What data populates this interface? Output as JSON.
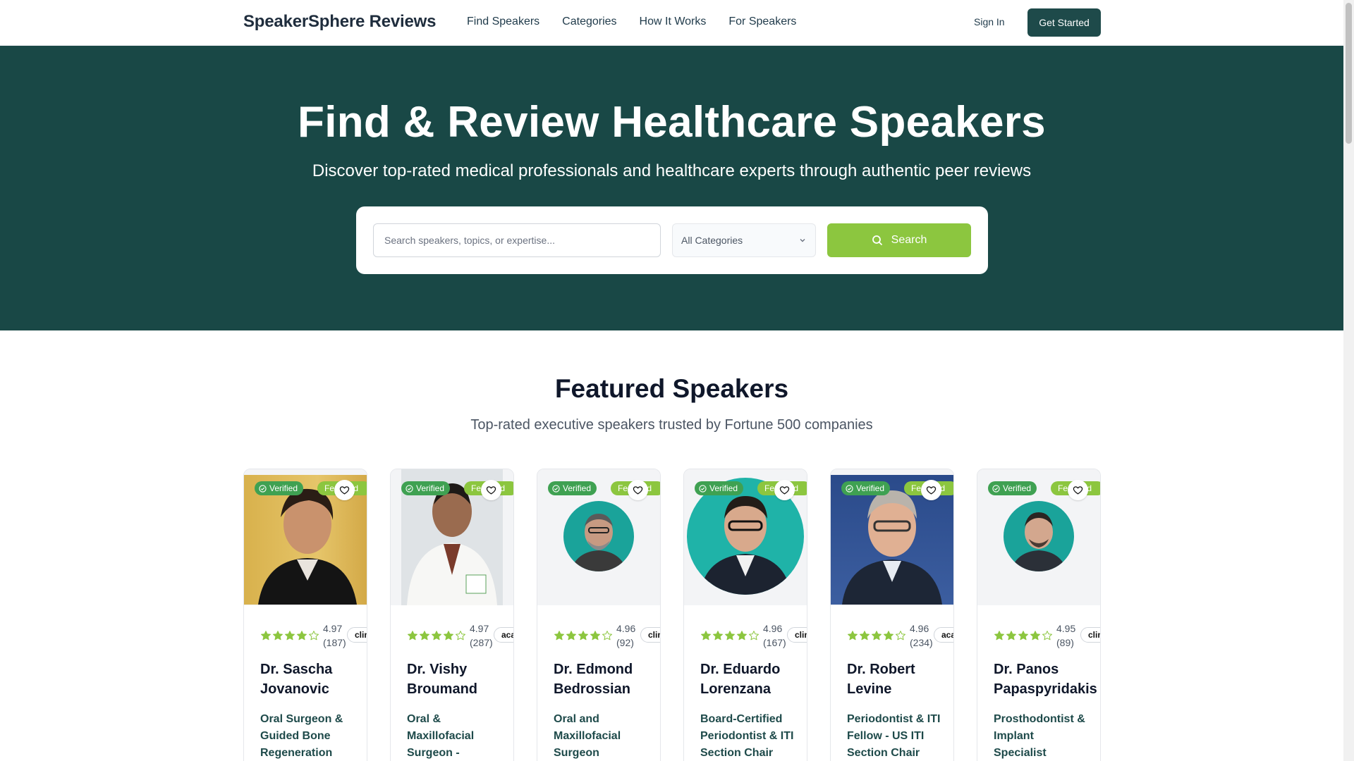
{
  "header": {
    "brand": "SpeakerSphere Reviews",
    "nav": [
      "Find Speakers",
      "Categories",
      "How It Works",
      "For Speakers"
    ],
    "sign_in": "Sign In",
    "get_started": "Get Started"
  },
  "hero": {
    "title": "Find & Review Healthcare Speakers",
    "subtitle": "Discover top-rated medical professionals and healthcare experts through authentic peer reviews",
    "search_placeholder": "Search speakers, topics, or expertise...",
    "category_selected": "All Categories",
    "search_button": "Search"
  },
  "featured": {
    "title": "Featured Speakers",
    "subtitle": "Top-rated executive speakers trusted by Fortune 500 companies",
    "badge_verified": "Verified",
    "badge_featured": "Featured",
    "speakers": [
      {
        "name": "Dr. Sascha Jovanovic",
        "title": "Oral Surgeon & Guided Bone Regeneration Pioneer",
        "rating": "4.97",
        "reviews": "(187)",
        "tag": "clinical",
        "stars": 4.97
      },
      {
        "name": "Dr. Vishy Broumand",
        "title": "Oral & Maxillofacial Surgeon - Zygomatic",
        "rating": "4.97",
        "reviews": "(287)",
        "tag": "academic",
        "stars": 4.97
      },
      {
        "name": "Dr. Edmond Bedrossian",
        "title": "Oral and Maxillofacial Surgeon",
        "rating": "4.96",
        "reviews": "(92)",
        "tag": "clinical",
        "stars": 4.96
      },
      {
        "name": "Dr. Eduardo Lorenzana",
        "title": "Board-Certified Periodontist & ITI Section Chair",
        "rating": "4.96",
        "reviews": "(167)",
        "tag": "clinical",
        "stars": 4.96
      },
      {
        "name": "Dr. Robert Levine",
        "title": "Periodontist & ITI Fellow - US ITI Section Chair",
        "rating": "4.96",
        "reviews": "(234)",
        "tag": "academic",
        "stars": 4.96
      },
      {
        "name": "Dr. Panos Papaspyridakis",
        "title": "Prosthodontist & Implant Specialist",
        "rating": "4.95",
        "reviews": "(89)",
        "tag": "clinical",
        "stars": 4.95
      }
    ]
  },
  "colors": {
    "hero_bg": "#194846",
    "accent_green": "#8cc63f",
    "verified_green": "#3fa152",
    "dark_teal": "#1e4a4a"
  }
}
